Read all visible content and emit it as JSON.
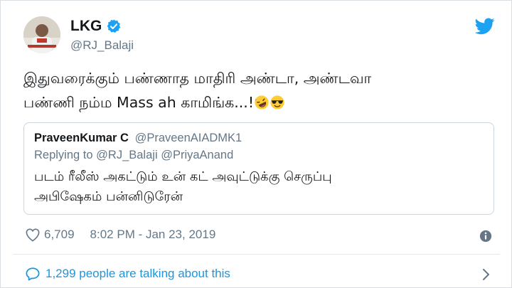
{
  "tweet": {
    "display_name": "LKG",
    "handle": "@RJ_Balaji",
    "text_line1": "இதுவரைக்கும் பண்ணாத மாதிரி அண்டா, அண்டவா",
    "text_line2": "பண்ணி நம்ம Mass ah காமிங்க...!",
    "likes": "6,709",
    "datetime": "8:02 PM - Jan 23, 2019",
    "talking": "1,299 people are talking about this"
  },
  "quoted": {
    "name": "PraveenKumar C",
    "handle": "@PraveenAIADMK1",
    "replying_prefix": "Replying to",
    "replying_to_1": "@RJ_Balaji",
    "replying_to_2": "@PriyaAnand",
    "text_line1": "படம் ரீலீஸ் அகட்டும் உன் கட் அவுட்டுக்கு செருப்பு",
    "text_line2": "அபிஷேகம் பன்னிடுரேன்"
  },
  "icons": [
    "verified-icon",
    "twitter-bird-icon",
    "rofl-emoji-icon",
    "sunglasses-emoji-icon",
    "heart-icon",
    "info-icon",
    "comment-bubble-icon",
    "chevron-right-icon"
  ],
  "colors": {
    "accent": "#1da1f2",
    "link": "#1b95e0",
    "muted": "#657786",
    "text": "#14171a"
  }
}
